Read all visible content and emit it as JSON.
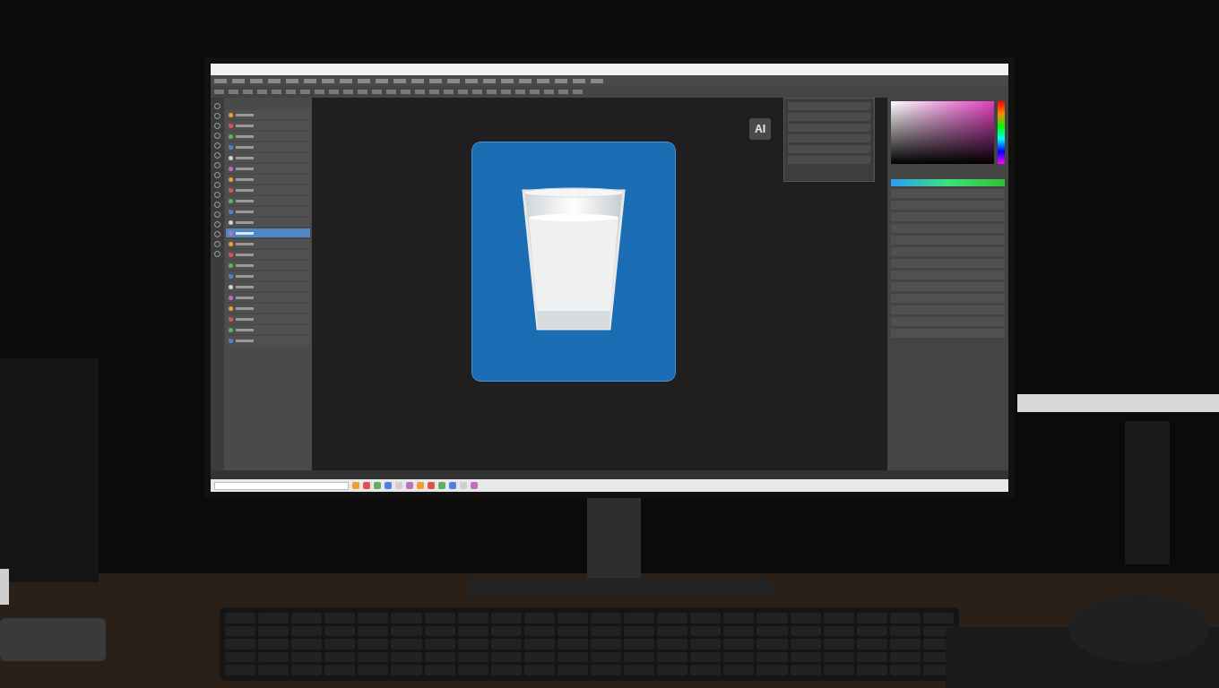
{
  "monitor": {
    "screen": {
      "badge": {
        "label": "AI"
      },
      "layers_panel": {
        "rows": [
          {
            "selected": false
          },
          {
            "selected": false
          },
          {
            "selected": false
          },
          {
            "selected": false
          },
          {
            "selected": false
          },
          {
            "selected": false
          },
          {
            "selected": false
          },
          {
            "selected": false
          },
          {
            "selected": false
          },
          {
            "selected": false
          },
          {
            "selected": false
          },
          {
            "selected": true
          },
          {
            "selected": false
          },
          {
            "selected": false
          },
          {
            "selected": false
          },
          {
            "selected": false
          },
          {
            "selected": false
          },
          {
            "selected": false
          },
          {
            "selected": false
          },
          {
            "selected": false
          },
          {
            "selected": false
          },
          {
            "selected": false
          }
        ]
      }
    }
  }
}
